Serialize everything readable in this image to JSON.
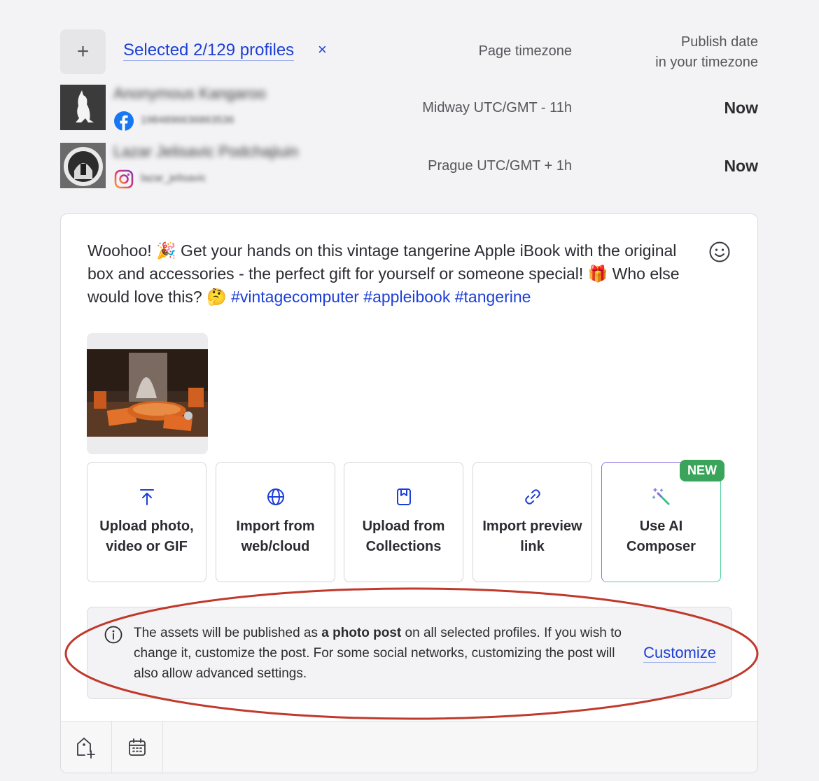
{
  "header": {
    "add_symbol": "+",
    "selected_label": "Selected 2/129 profiles",
    "clear_symbol": "×",
    "col_timezone": "Page timezone",
    "col_publish_line1": "Publish date",
    "col_publish_line2": "in your timezone"
  },
  "profiles": [
    {
      "name": "Anonymous Kangaroo",
      "id": "1984896636863536",
      "network": "facebook",
      "timezone": "Midway UTC/GMT - 11h",
      "publish": "Now"
    },
    {
      "name": "Lazar Jelisavic Podchajiuin",
      "id": "lazar_jelisavic",
      "network": "instagram",
      "timezone": "Prague UTC/GMT + 1h",
      "publish": "Now"
    }
  ],
  "composer": {
    "text_main": "Woohoo! 🎉 Get your hands on this vintage tangerine Apple iBook with the original box and accessories - the perfect gift for yourself or someone special! 🎁 Who else would love this? 🤔 ",
    "hashtags": "#vintagecomputer #appleibook #tangerine",
    "actions": [
      {
        "icon": "upload-arrow-icon",
        "label": "Upload photo,\nvideo or GIF"
      },
      {
        "icon": "globe-icon",
        "label": "Import from\nweb/cloud"
      },
      {
        "icon": "bookmark-icon",
        "label": "Upload from\nCollections"
      },
      {
        "icon": "link-icon",
        "label": "Import preview\nlink"
      },
      {
        "icon": "magic-wand-icon",
        "label": "Use AI\nComposer",
        "badge": "NEW"
      }
    ],
    "info": {
      "text_before": "The assets will be published as ",
      "text_bold": "a photo post",
      "text_after": " on all selected profiles. If you wish to change it, customize the post. For some social networks, customizing the post will also allow advanced settings.",
      "customize_label": "Customize"
    }
  },
  "colors": {
    "link": "#1d3fd6",
    "badge_green": "#3aa55a",
    "annotation_red": "#c0392b"
  }
}
